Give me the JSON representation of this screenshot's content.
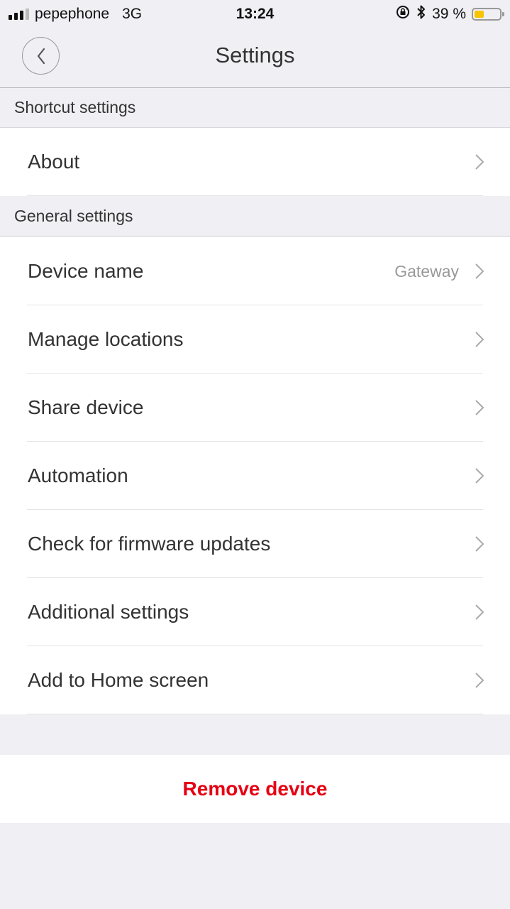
{
  "status_bar": {
    "carrier": "pepephone",
    "network": "3G",
    "time": "13:24",
    "signal_bars_active": 3,
    "signal_bars_total": 4,
    "rotation_lock_icon": "rotation-lock-icon",
    "bluetooth_icon": "bluetooth-icon",
    "battery_percent_label": "39 %",
    "battery_level": 0.39,
    "battery_color": "#f7c500"
  },
  "navbar": {
    "title": "Settings",
    "back_icon": "chevron-left-icon"
  },
  "sections": [
    {
      "header": "Shortcut settings",
      "items": [
        {
          "label": "About",
          "value": ""
        }
      ]
    },
    {
      "header": "General settings",
      "items": [
        {
          "label": "Device name",
          "value": "Gateway"
        },
        {
          "label": "Manage locations",
          "value": ""
        },
        {
          "label": "Share device",
          "value": ""
        },
        {
          "label": "Automation",
          "value": ""
        },
        {
          "label": "Check for firmware updates",
          "value": ""
        },
        {
          "label": "Additional settings",
          "value": ""
        },
        {
          "label": "Add to Home screen",
          "value": ""
        }
      ]
    }
  ],
  "remove_button": {
    "label": "Remove device",
    "color": "#e60012"
  }
}
